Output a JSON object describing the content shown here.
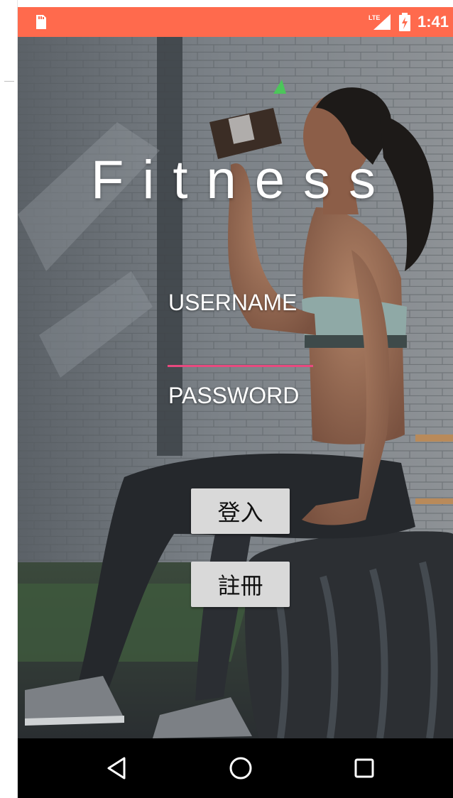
{
  "status_bar": {
    "time": "1:41",
    "network": "LTE",
    "icons": [
      "sd-card-icon",
      "lte-signal-icon",
      "battery-icon"
    ]
  },
  "app": {
    "title": "Fitness",
    "username_placeholder": "USERNAME",
    "password_placeholder": "PASSWORD",
    "login_button": "登入",
    "register_button": "註冊"
  },
  "navigation_bar": {
    "icons": [
      "back-icon",
      "home-icon",
      "recents-icon"
    ]
  },
  "colors": {
    "status_bar": "#ff6a4d",
    "accent_underline": "#e8497f",
    "button_bg": "#d9d9d9",
    "nav_bar": "#000000"
  }
}
